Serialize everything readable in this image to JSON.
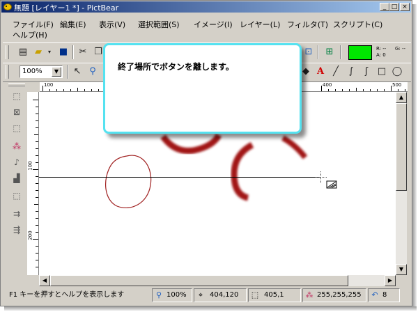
{
  "window": {
    "title": "無題 [レイヤー1 *] - PictBear",
    "controls": {
      "minimize": "_",
      "maximize": "□",
      "close": "×"
    }
  },
  "menu": [
    "ファイル(F)",
    "編集(E)",
    "表示(V)",
    "選択範囲(S)",
    "イメージ(I)",
    "レイヤー(L)",
    "フィルタ(T)",
    "スクリプト(C)",
    "ヘルプ(H)"
  ],
  "toolbar": {
    "zoom": "100%",
    "foreground_color": "#00e600",
    "rgb_readout": {
      "r": "R: --",
      "g": "G: --",
      "a": "A: 0"
    }
  },
  "rulers": {
    "h_labels": [
      "100",
      "400",
      "500"
    ],
    "v_labels": [
      "100",
      "200"
    ]
  },
  "tooltip": {
    "text": "終了場所でボタンを離します。",
    "border_color": "#55e2f0"
  },
  "statusbar": {
    "help_text": "F1 キーを押すとヘルプを表示します",
    "zoom": "100%",
    "cursor_pos": "404,120",
    "selection_size": "405,1",
    "color_value": "255,255,255",
    "undo_count": "8"
  }
}
